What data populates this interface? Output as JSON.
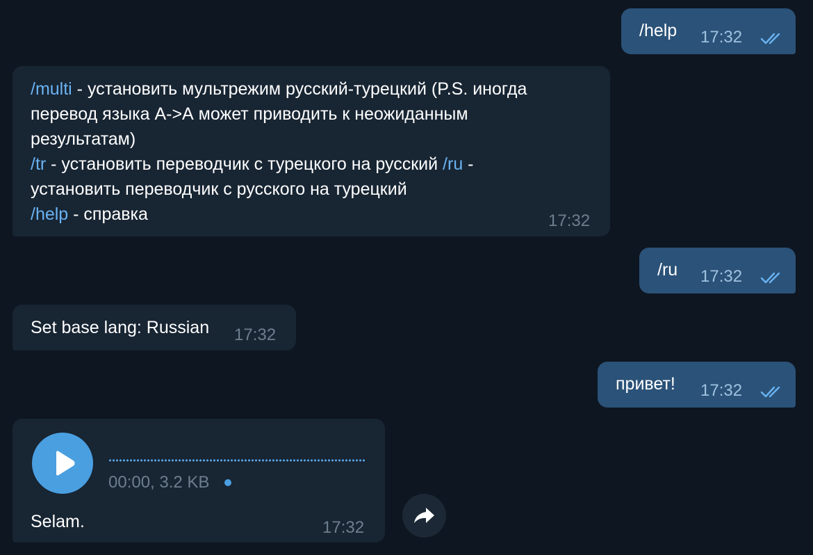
{
  "messages": {
    "m1": {
      "text": "/help",
      "time": "17:32"
    },
    "m2": {
      "cmd_multi": "/multi",
      "line1_rest": " - установить мультрежим русский-турецкий (P.S. иногда",
      "line2": "перевод языка А->А может приводить к неожиданным",
      "line3": "результатам)",
      "cmd_tr": "/tr",
      "line4_mid": " - установить переводчик с турецкого на русский ",
      "cmd_ru": "/ru",
      "line4_end": " -",
      "line5": "установить переводчик с русского на турецкий",
      "cmd_help": "/help",
      "line6_rest": " - справка",
      "time": "17:32"
    },
    "m3": {
      "text": "/ru",
      "time": "17:32"
    },
    "m4": {
      "text": "Set base lang: Russian",
      "time": "17:32"
    },
    "m5": {
      "text": "привет!",
      "time": "17:32"
    },
    "m6": {
      "voice_meta": "00:00, 3.2 KB",
      "caption": "Selam.",
      "time": "17:32"
    }
  },
  "icons": {
    "read_check": "double-check-icon",
    "play": "play-icon",
    "share": "share-icon"
  },
  "colors": {
    "background": "#0e1621",
    "incoming_bubble": "#182533",
    "outgoing_bubble": "#2b5278",
    "link": "#6ab3f3",
    "accent": "#4a9fe1"
  }
}
